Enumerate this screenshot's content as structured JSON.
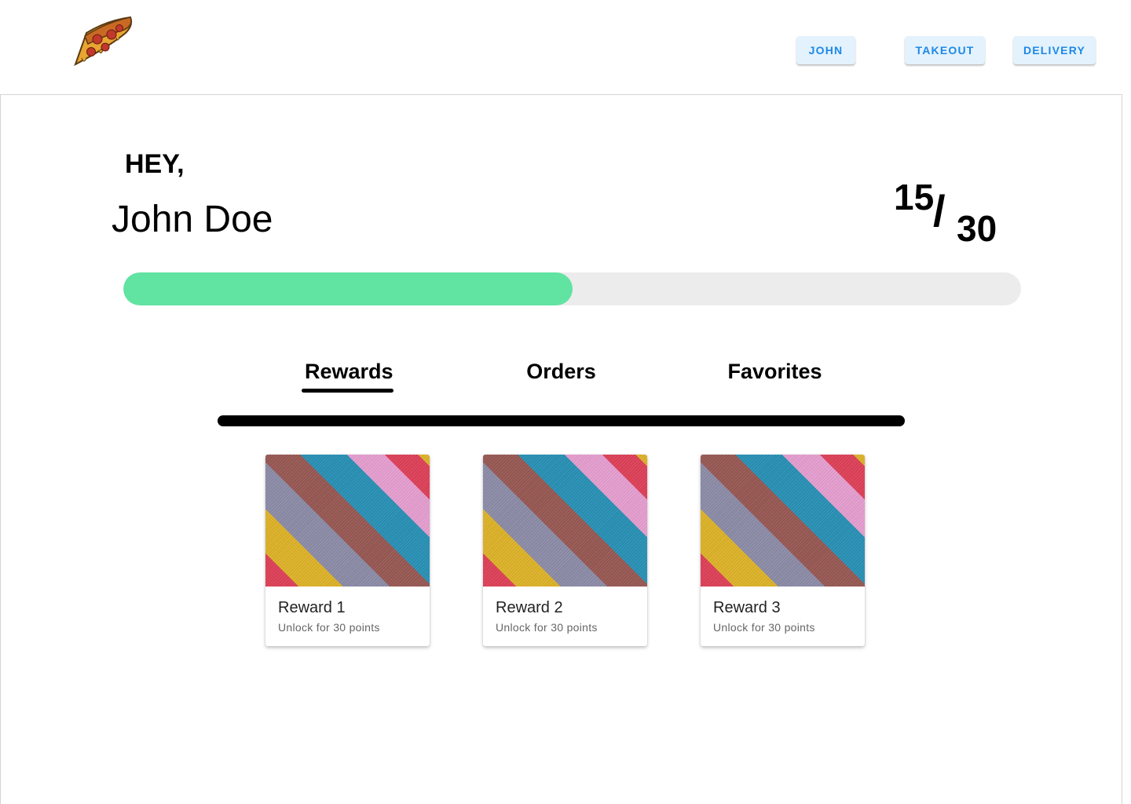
{
  "header": {
    "nav": [
      {
        "label": "JOHN"
      },
      {
        "label": "TAKEOUT"
      },
      {
        "label": "DELIVERY"
      }
    ]
  },
  "greeting": {
    "hey": "HEY,",
    "name": "John Doe"
  },
  "points": {
    "current": "15",
    "separator": "/",
    "goal": "30",
    "progress_fraction": 0.5
  },
  "tabs": [
    {
      "label": "Rewards",
      "active": true
    },
    {
      "label": "Orders",
      "active": false
    },
    {
      "label": "Favorites",
      "active": false
    }
  ],
  "rewards": [
    {
      "title": "Reward 1",
      "subtitle": "Unlock for 30 points"
    },
    {
      "title": "Reward 2",
      "subtitle": "Unlock for 30 points"
    },
    {
      "title": "Reward 3",
      "subtitle": "Unlock for 30 points"
    }
  ],
  "colors": {
    "accent": "#1e88e5",
    "button_bg": "#e3f2fd",
    "progress": "#61e3a2",
    "track": "#ececec"
  }
}
